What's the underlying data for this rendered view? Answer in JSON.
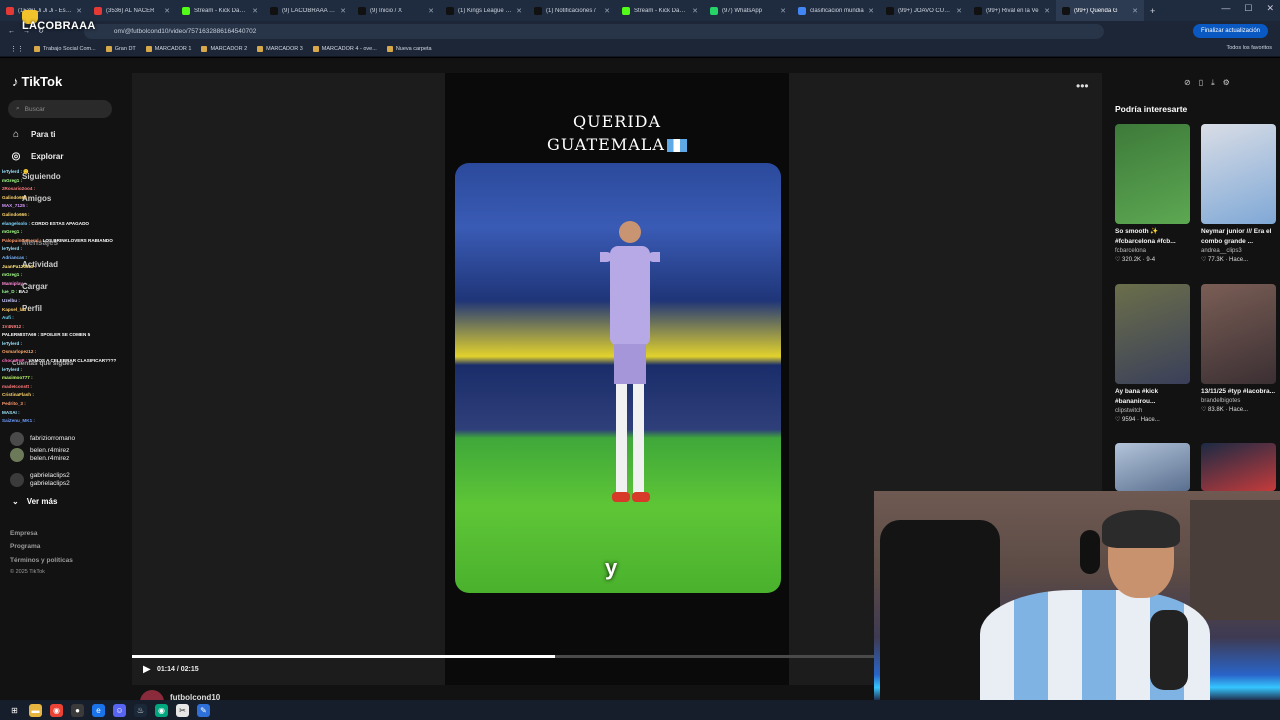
{
  "browser": {
    "tabs": [
      {
        "label": "(1536) Ji Ji Ji - Estas",
        "color": "#e53935"
      },
      {
        "label": "(3536) AL NACER",
        "color": "#e53935"
      },
      {
        "label": "Stream - Kick Dashb",
        "color": "#53fc18"
      },
      {
        "label": "(9) LACOBRAAA Ou",
        "color": "#111111"
      },
      {
        "label": "(9) Inicio / X",
        "color": "#111111"
      },
      {
        "label": "(1) Kings League Sp",
        "color": "#111111"
      },
      {
        "label": "(1) Notificaciones /",
        "color": "#111111"
      },
      {
        "label": "Stream - Kick Dashb",
        "color": "#53fc18"
      },
      {
        "label": "(97) WhatsApp",
        "color": "#25d366"
      },
      {
        "label": "clasificacion mundia",
        "color": "#4285f4"
      },
      {
        "label": "(99+) JOAVO CUENT",
        "color": "#111111"
      },
      {
        "label": "(99+) Rival en la Ve",
        "color": "#111111"
      },
      {
        "label": "(99+) Querida G",
        "color": "#111111",
        "active": true
      }
    ],
    "url": "om/@futbolcond10/video/7571632886164540702",
    "update_button": "Finalizar actualización",
    "bookmarks": [
      "Trabajo Social Com...",
      "Gran DT",
      "MARCADOR 1",
      "MARCADOR 2",
      "MARCADOR 3",
      "MARCADOR 4 - ove...",
      "Nueva carpeta"
    ],
    "bookmarks_all": "Todos los favoritos"
  },
  "stream_logo": "LACOBRAAA",
  "tiktok": {
    "logo": "TikTok",
    "search_placeholder": "Buscar",
    "nav": [
      "Para ti",
      "Explorar",
      "Siguiendo",
      "Amigos",
      "Mensajes",
      "Actividad",
      "Cargar",
      "Perfil"
    ],
    "following_header": "Cuentas que sigues",
    "following": [
      {
        "name": "fabriziorromano",
        "user": ""
      },
      {
        "name": "belen.r4mirez",
        "user": "belen.r4mirez"
      },
      {
        "name": "gabrielaclips2",
        "user": "gabrielaclips2"
      }
    ],
    "ver_mas": "Ver más",
    "footer": [
      "Empresa",
      "Programa",
      "Términos y políticas",
      "© 2025 TikTok"
    ],
    "video": {
      "caption_line1": "QUERIDA",
      "caption_line2": "GUATEMALA",
      "subtitle": "y",
      "time": "01:14 / 02:15",
      "progress": 0.57,
      "author": "futbolcond10"
    },
    "recommend_title": "Podría interesarte",
    "recommendations": [
      {
        "title": "So smooth ✨ #fcbarcelona #fcb...",
        "author": "fcbarcelona",
        "stats": "320.2K · 9-4",
        "color1": "#3d7a3a",
        "color2": "#5da852"
      },
      {
        "title": "Neymar junior /// Era el combo grande ...",
        "author": "andrea__clips3",
        "stats": "77.3K · Hace...",
        "color1": "#d9dde6",
        "color2": "#7fa8d6"
      },
      {
        "title": "Ay bana #kick #bananirou...",
        "author": "clipstwitch",
        "stats": "9594 · Hace...",
        "color1": "#6b6f4a",
        "color2": "#3a3f5a"
      },
      {
        "title": "13/11/25 #typ #lacobra...",
        "author": "brandelbigotes",
        "stats": "83.8K · Hace...",
        "color1": "#7a5e55",
        "color2": "#3b2f33"
      },
      {
        "title": "",
        "author": "",
        "stats": "",
        "color1": "#b3c4da",
        "color2": "#5a6f8f"
      },
      {
        "title": "",
        "author": "",
        "stats": "",
        "color1": "#1b2a44",
        "color2": "#c53b3b"
      }
    ]
  },
  "chat": [
    {
      "user": "leTylerd :",
      "msg": "🙂",
      "color": "#9be4ff"
    },
    {
      "user": "mGreg1 :",
      "msg": "",
      "color": "#a3ff86"
    },
    {
      "user": "2Rosario2oo4 :",
      "msg": "",
      "color": "#ff7b7b"
    },
    {
      "user": "Galindo666 :",
      "msg": "",
      "color": "#ffd56b"
    },
    {
      "user": "MAX_7125 :",
      "msg": "",
      "color": "#d99bff"
    },
    {
      "user": "Galindo666 :",
      "msg": "",
      "color": "#ffd56b"
    },
    {
      "user": "elangelsolo :",
      "msg": "CORDO ESTAS APAGADO",
      "color": "#7cd8ff"
    },
    {
      "user": "mGreg1 :",
      "msg": "",
      "color": "#a3ff86"
    },
    {
      "user": "PalopuinGeneral :",
      "msg": "LOS BRINKLOVERS RABIANDO",
      "color": "#ff9a6b"
    },
    {
      "user": "leTylerd :",
      "msg": "",
      "color": "#9be4ff"
    },
    {
      "user": "Adriancas :",
      "msg": "",
      "color": "#7bb8ff"
    },
    {
      "user": "JuanPa120512 :",
      "msg": "",
      "color": "#ffe27b"
    },
    {
      "user": "mGreg1 :",
      "msg": "",
      "color": "#a3ff86"
    },
    {
      "user": "Mamiplay :",
      "msg": "",
      "color": "#ff8bd6"
    },
    {
      "user": "lue_D :",
      "msg": "BAJ",
      "color": "#9cff9c"
    },
    {
      "user": "Uzelbu :",
      "msg": "",
      "color": "#c6c6ff"
    },
    {
      "user": "Kapsel_lad :",
      "msg": "",
      "color": "#ffcf6b"
    },
    {
      "user": "Aufi :",
      "msg": "",
      "color": "#6bdcff"
    },
    {
      "user": "1V4N912 :",
      "msg": "",
      "color": "#ff8080"
    },
    {
      "user": "PALERMISTA69 :",
      "msg": "SPOILER SE COMEN 5",
      "color": "#ffffff"
    },
    {
      "user": "leTylerd :",
      "msg": "",
      "color": "#9be4ff"
    },
    {
      "user": "Osmarlopez12 :",
      "msg": "",
      "color": "#ffa86b"
    },
    {
      "user": "chocoPoP :",
      "msg": "VAMOS A CELEBRAR CLASIFICAR????",
      "color": "#ff6bbd"
    },
    {
      "user": "leTylerd :",
      "msg": "",
      "color": "#9be4ff"
    },
    {
      "user": "maximoo777 :",
      "msg": "",
      "color": "#c1ff6b"
    },
    {
      "user": "madeIconstt :",
      "msg": "",
      "color": "#ff7b7b"
    },
    {
      "user": "CristinaFlash :",
      "msg": "",
      "color": "#ffd56b"
    },
    {
      "user": "Pedrito_3 :",
      "msg": "",
      "color": "#ff9a6b"
    },
    {
      "user": "MASAI :",
      "msg": "",
      "color": "#9be4ff"
    },
    {
      "user": "SaiZenu_MK1 :",
      "msg": "",
      "color": "#6b9bff"
    }
  ],
  "taskbar": {
    "icons": [
      "windows-icon",
      "folder-icon",
      "chrome-icon",
      "obs-icon",
      "edge-icon",
      "discord-icon",
      "steam-icon",
      "chrome-dev-icon",
      "capcut-icon",
      "notepad-icon"
    ]
  },
  "colors": {
    "tiktok_bg": "#121212",
    "accent": "#fe2c55",
    "update_button": "#0a58c2"
  }
}
